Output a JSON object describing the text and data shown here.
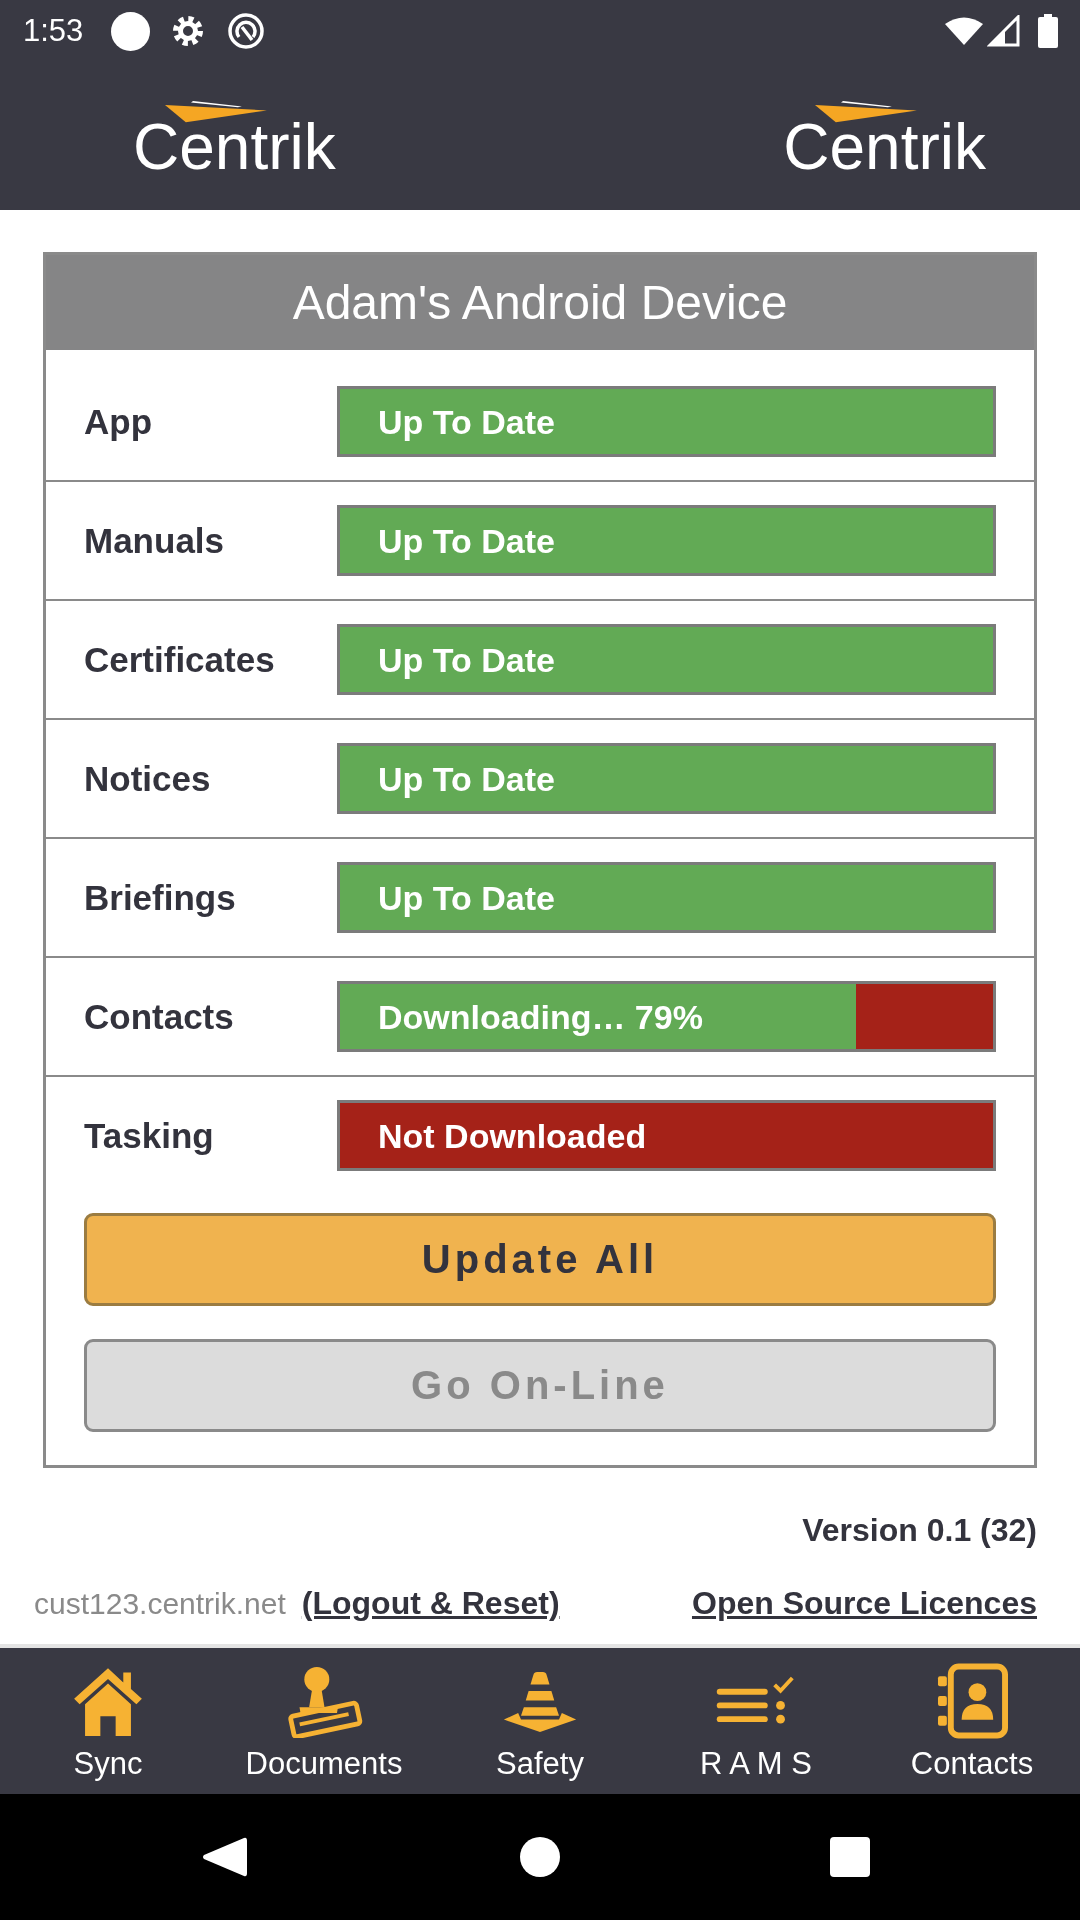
{
  "status_bar": {
    "time": "1:53"
  },
  "header": {
    "logos": [
      "Centrik",
      "Centrik"
    ]
  },
  "device": {
    "title": "Adam's Android Device",
    "items": [
      {
        "label": "App",
        "status": "Up To Date",
        "level": 1
      },
      {
        "label": "Manuals",
        "status": "Up To Date",
        "level": 1
      },
      {
        "label": "Certificates",
        "status": "Up To Date",
        "level": 1
      },
      {
        "label": "Notices",
        "status": "Up To Date",
        "level": 1
      },
      {
        "label": "Briefings",
        "status": "Up To Date",
        "level": 1
      },
      {
        "label": "Contacts",
        "status": "Downloading… 79%",
        "level": 0.79
      },
      {
        "label": "Tasking",
        "status": "Not Downloaded",
        "level": 0
      }
    ],
    "buttons": [
      {
        "label": "Update All",
        "disabled": false
      },
      {
        "label": "Go On-Line",
        "disabled": true
      }
    ]
  },
  "footer": {
    "version": "Version 0.1 (32)",
    "host": "cust123.centrik.net",
    "links": [
      "(Logout & Reset)",
      "Open Source Licences"
    ]
  },
  "bottom_nav": [
    {
      "label": "Sync"
    },
    {
      "label": "Documents"
    },
    {
      "label": "Safety"
    },
    {
      "label": "R A M S"
    },
    {
      "label": "Contacts"
    }
  ]
}
